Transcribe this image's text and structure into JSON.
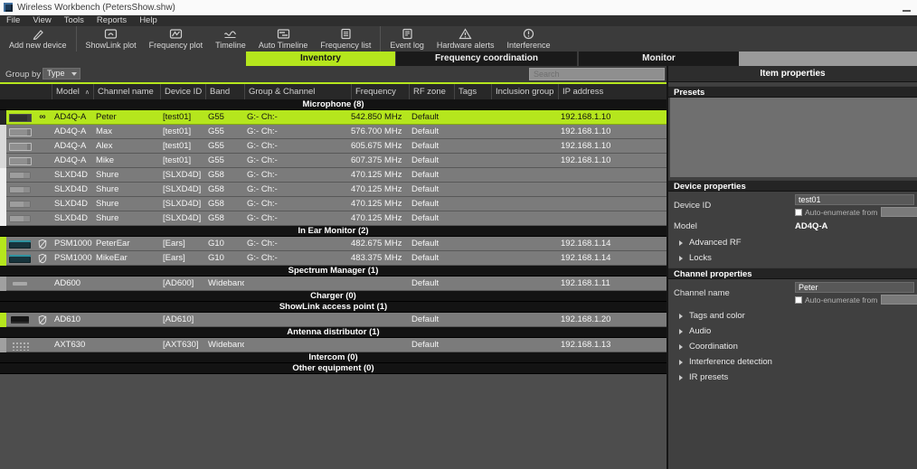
{
  "window": {
    "title": "Wireless Workbench (PetersShow.shw)",
    "app_icon": "wireless-workbench-icon",
    "minimize_icon": "minimize-icon"
  },
  "menu": {
    "items": [
      "File",
      "View",
      "Tools",
      "Reports",
      "Help"
    ]
  },
  "toolbar": {
    "buttons": [
      {
        "label": "Add new device",
        "icon": "add-new-device-icon"
      },
      {
        "label": "ShowLink plot",
        "icon": "showlink-plot-icon"
      },
      {
        "label": "Frequency plot",
        "icon": "frequency-plot-icon"
      },
      {
        "label": "Timeline",
        "icon": "timeline-icon"
      },
      {
        "label": "Auto Timeline",
        "icon": "auto-timeline-icon"
      },
      {
        "label": "Frequency list",
        "icon": "frequency-list-icon"
      },
      {
        "label": "Event log",
        "icon": "event-log-icon"
      },
      {
        "label": "Hardware alerts",
        "icon": "hardware-alerts-icon"
      },
      {
        "label": "Interference",
        "icon": "interference-icon"
      }
    ]
  },
  "tabs": [
    {
      "label": "Inventory",
      "active": true
    },
    {
      "label": "Frequency coordination",
      "active": false
    },
    {
      "label": "Monitor",
      "active": false
    }
  ],
  "controls": {
    "group_by_label": "Group by",
    "group_by_value": "Type",
    "search_placeholder": "Search"
  },
  "ui_colors": {
    "accent_green": "#b5e61d",
    "selected_row": "#b5e61d",
    "section_header_bg": "#131313",
    "row_bg": "#7b7b7b"
  },
  "table": {
    "columns": [
      "",
      "Model",
      "Channel name",
      "Device ID",
      "Band",
      "Group & Channel",
      "Frequency",
      "RF zone",
      "Tags",
      "Inclusion group",
      "IP address"
    ],
    "sort": {
      "column": "Model",
      "direction": "asc"
    },
    "sections": [
      {
        "label": "Microphone (8)",
        "rows": [
          {
            "model": "AD4Q-A",
            "channel": "Peter",
            "device_id": "[test01]",
            "band": "G55",
            "group": "G:- Ch:-",
            "frequency": "542.850 MHz",
            "rf_zone": "Default",
            "tags": "",
            "inclusion": "",
            "ip": "192.168.1.10",
            "selected": true,
            "strip": "#262626",
            "icon": "ad4q-receiver-icon",
            "link": true,
            "shield": false
          },
          {
            "model": "AD4Q-A",
            "channel": "Max",
            "device_id": "[test01]",
            "band": "G55",
            "group": "G:- Ch:-",
            "frequency": "576.700 MHz",
            "rf_zone": "Default",
            "tags": "",
            "inclusion": "",
            "ip": "192.168.1.10",
            "selected": false,
            "strip": "#d9d9d9",
            "icon": "ad4q-receiver-icon",
            "link": false,
            "shield": false
          },
          {
            "model": "AD4Q-A",
            "channel": "Alex",
            "device_id": "[test01]",
            "band": "G55",
            "group": "G:- Ch:-",
            "frequency": "605.675 MHz",
            "rf_zone": "Default",
            "tags": "",
            "inclusion": "",
            "ip": "192.168.1.10",
            "selected": false,
            "strip": "#d9d9d9",
            "icon": "ad4q-receiver-icon",
            "link": false,
            "shield": false
          },
          {
            "model": "AD4Q-A",
            "channel": "Mike",
            "device_id": "[test01]",
            "band": "G55",
            "group": "G:- Ch:-",
            "frequency": "607.375 MHz",
            "rf_zone": "Default",
            "tags": "",
            "inclusion": "",
            "ip": "192.168.1.10",
            "selected": false,
            "strip": "#d9d9d9",
            "icon": "ad4q-receiver-icon",
            "link": false,
            "shield": false
          },
          {
            "model": "SLXD4D",
            "channel": "Shure",
            "device_id": "[SLXD4D]",
            "band": "G58",
            "group": "G:- Ch:-",
            "frequency": "470.125 MHz",
            "rf_zone": "Default",
            "tags": "",
            "inclusion": "",
            "ip": "",
            "selected": false,
            "strip": "#efefef",
            "icon": "slxd-receiver-icon",
            "link": false,
            "shield": false
          },
          {
            "model": "SLXD4D",
            "channel": "Shure",
            "device_id": "[SLXD4D]",
            "band": "G58",
            "group": "G:- Ch:-",
            "frequency": "470.125 MHz",
            "rf_zone": "Default",
            "tags": "",
            "inclusion": "",
            "ip": "",
            "selected": false,
            "strip": "#efefef",
            "icon": "slxd-receiver-icon",
            "link": false,
            "shield": false
          },
          {
            "model": "SLXD4D",
            "channel": "Shure",
            "device_id": "[SLXD4D]",
            "band": "G58",
            "group": "G:- Ch:-",
            "frequency": "470.125 MHz",
            "rf_zone": "Default",
            "tags": "",
            "inclusion": "",
            "ip": "",
            "selected": false,
            "strip": "#efefef",
            "icon": "slxd-receiver-icon",
            "link": false,
            "shield": false
          },
          {
            "model": "SLXD4D",
            "channel": "Shure",
            "device_id": "[SLXD4D]",
            "band": "G58",
            "group": "G:- Ch:-",
            "frequency": "470.125 MHz",
            "rf_zone": "Default",
            "tags": "",
            "inclusion": "",
            "ip": "",
            "selected": false,
            "strip": "#efefef",
            "icon": "slxd-receiver-icon",
            "link": false,
            "shield": false
          }
        ]
      },
      {
        "label": "In Ear Monitor (2)",
        "rows": [
          {
            "model": "PSM1000",
            "channel": "PeterEar",
            "device_id": "[Ears]",
            "band": "G10",
            "group": "G:- Ch:-",
            "frequency": "482.675 MHz",
            "rf_zone": "Default",
            "tags": "",
            "inclusion": "",
            "ip": "192.168.1.14",
            "selected": false,
            "strip": "#b5e61d",
            "icon": "psm-transmitter-icon",
            "link": false,
            "shield": true
          },
          {
            "model": "PSM1000",
            "channel": "MikeEar",
            "device_id": "[Ears]",
            "band": "G10",
            "group": "G:- Ch:-",
            "frequency": "483.375 MHz",
            "rf_zone": "Default",
            "tags": "",
            "inclusion": "",
            "ip": "192.168.1.14",
            "selected": false,
            "strip": "#b5e61d",
            "icon": "psm-transmitter-icon",
            "link": false,
            "shield": true
          }
        ]
      },
      {
        "label": "Spectrum Manager (1)",
        "rows": [
          {
            "model": "AD600",
            "channel": "",
            "device_id": "[AD600]",
            "band": "Wideband",
            "group": "",
            "frequency": "",
            "rf_zone": "Default",
            "tags": "",
            "inclusion": "",
            "ip": "192.168.1.11",
            "selected": false,
            "strip": "#a0a0a0",
            "icon": "spectrum-manager-icon",
            "link": false,
            "shield": false
          }
        ]
      },
      {
        "label": "Charger (0)",
        "rows": []
      },
      {
        "label": "ShowLink access point (1)",
        "rows": [
          {
            "model": "AD610",
            "channel": "",
            "device_id": "[AD610]",
            "band": "",
            "group": "",
            "frequency": "",
            "rf_zone": "Default",
            "tags": "",
            "inclusion": "",
            "ip": "192.168.1.20",
            "selected": false,
            "strip": "#b5e61d",
            "icon": "access-point-icon",
            "link": false,
            "shield": true
          }
        ]
      },
      {
        "label": "Antenna distributor (1)",
        "rows": [
          {
            "model": "AXT630",
            "channel": "",
            "device_id": "[AXT630]",
            "band": "Wideband",
            "group": "",
            "frequency": "",
            "rf_zone": "Default",
            "tags": "",
            "inclusion": "",
            "ip": "192.168.1.13",
            "selected": false,
            "strip": "#a0a0a0",
            "icon": "antenna-distributor-icon",
            "link": false,
            "shield": false
          }
        ]
      },
      {
        "label": "Intercom (0)",
        "rows": []
      },
      {
        "label": "Other equipment (0)",
        "rows": []
      }
    ]
  },
  "properties": {
    "title": "Item properties",
    "presets_title": "Presets",
    "device": {
      "title": "Device properties",
      "device_id_label": "Device ID",
      "device_id_value": "test01",
      "auto_enumerate_label": "Auto-enumerate from",
      "model_label": "Model",
      "model_value": "AD4Q-A",
      "groups": [
        "Advanced RF",
        "Locks"
      ]
    },
    "channel": {
      "title": "Channel properties",
      "channel_name_label": "Channel name",
      "channel_name_value": "Peter",
      "auto_enumerate_label": "Auto-enumerate from",
      "groups": [
        "Tags and color",
        "Audio",
        "Coordination",
        "Interference detection",
        "IR presets"
      ]
    }
  }
}
